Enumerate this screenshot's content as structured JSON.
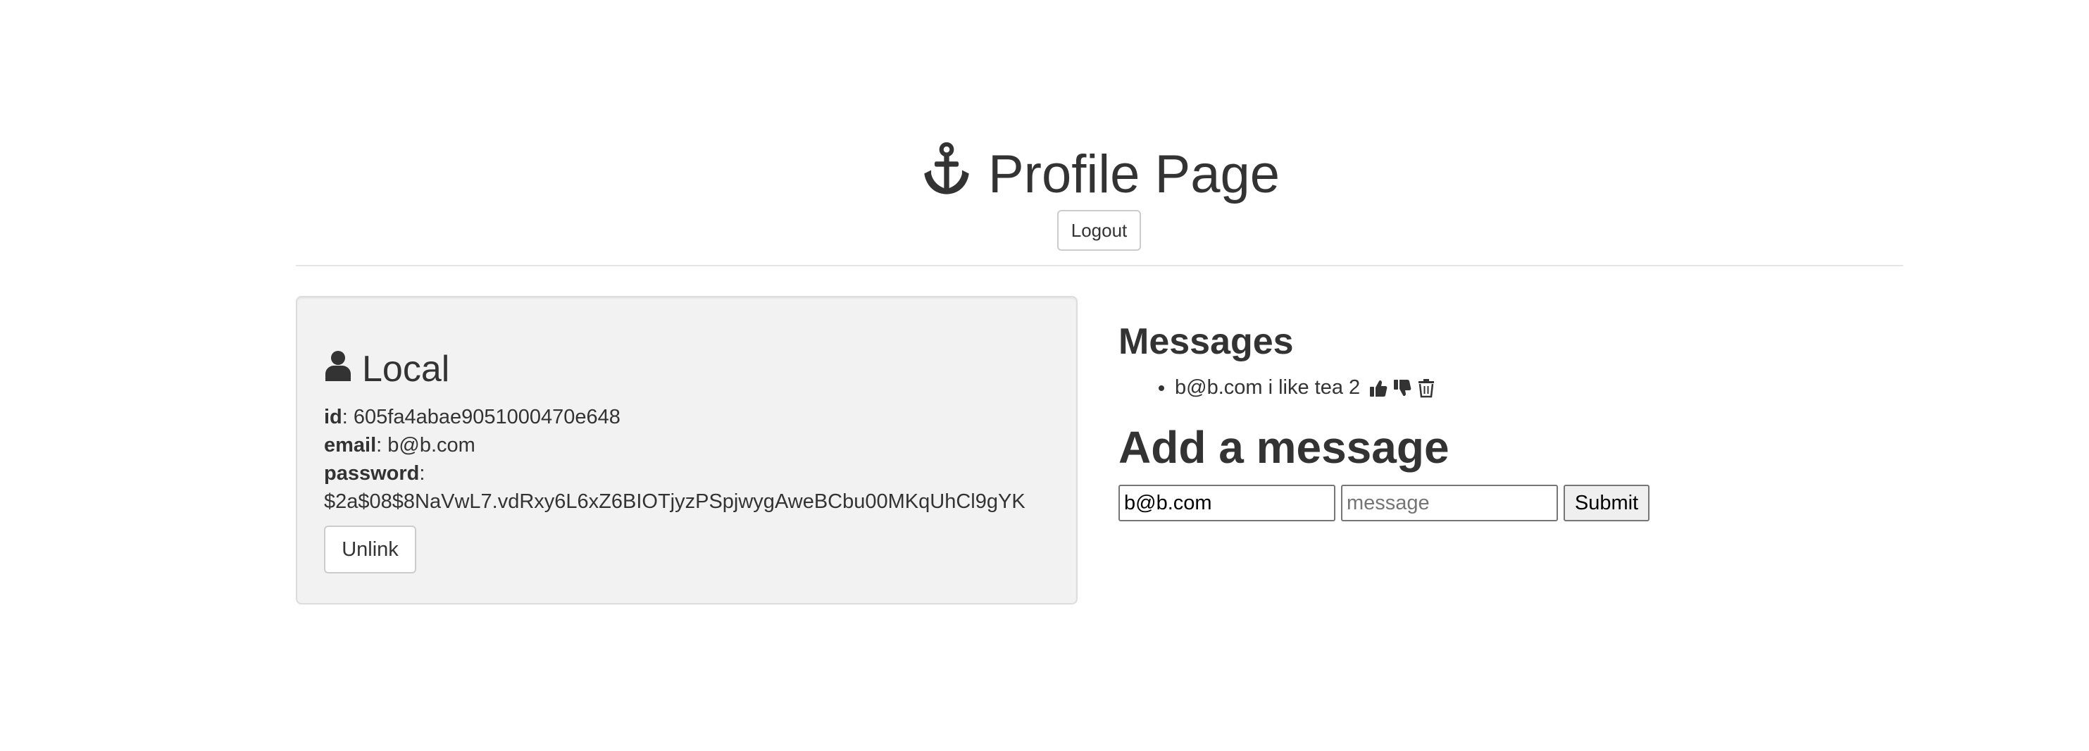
{
  "header": {
    "title": "Profile Page",
    "logout_label": "Logout"
  },
  "local": {
    "heading": "Local",
    "id_label": "id",
    "id_value": "605fa4abae9051000470e648",
    "email_label": "email",
    "email_value": "b@b.com",
    "password_label": "password",
    "password_value": "$2a$08$8NaVwL7.vdRxy6L6xZ6BIOTjyzPSpjwygAweBCbu00MKqUhCl9gYK",
    "unlink_label": "Unlink"
  },
  "messages": {
    "heading": "Messages",
    "items": [
      {
        "text": "b@b.com i like tea 2"
      }
    ]
  },
  "add_message": {
    "heading": "Add a message",
    "name_value": "b@b.com",
    "message_placeholder": "message",
    "submit_label": "Submit"
  },
  "icons": {
    "title": "anchor-icon",
    "local": "user-icon",
    "like": "thumbs-up-icon",
    "dislike": "thumbs-down-icon",
    "delete": "trash-icon"
  }
}
